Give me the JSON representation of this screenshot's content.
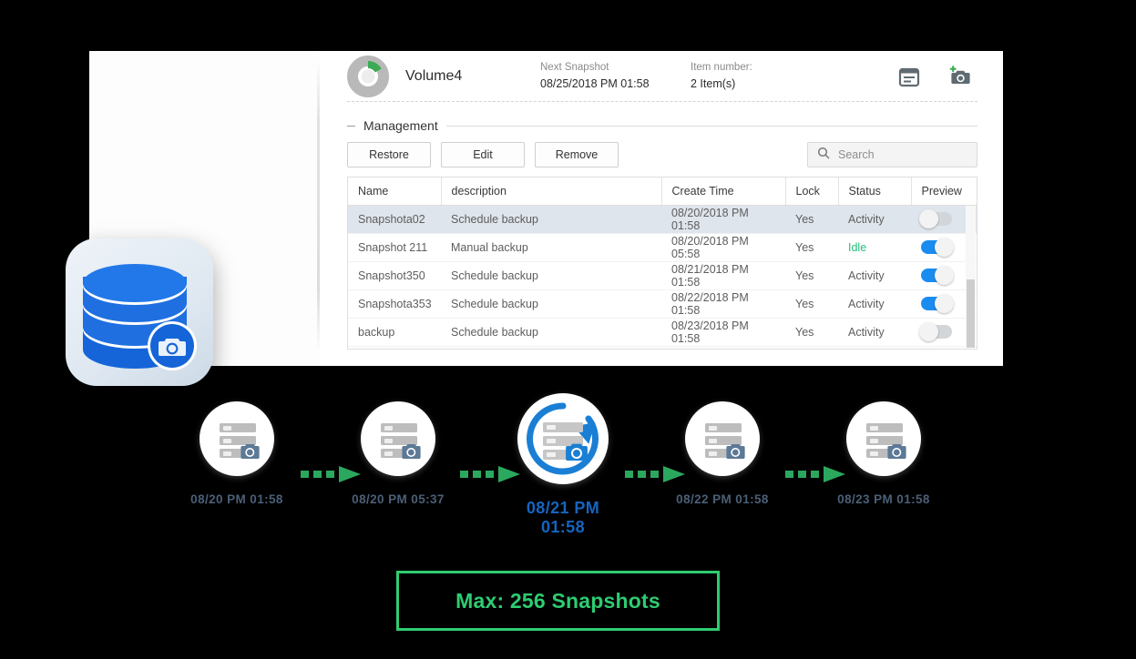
{
  "window": {
    "volume": {
      "donut_icon": "volume-usage-donut-icon",
      "name": "Volume4",
      "next_snapshot_label": "Next Snapshot",
      "next_snapshot_value": "08/25/2018 PM 01:58",
      "item_number_label": "Item number:",
      "item_number_value": "2 Item(s)",
      "icons": [
        {
          "name": "schedule-icon",
          "title": "Schedule"
        },
        {
          "name": "take-snapshot-icon",
          "title": "Take Snapshot"
        }
      ]
    },
    "management": {
      "legend": "Management",
      "buttons": [
        {
          "name": "restore-button",
          "label": "Restore"
        },
        {
          "name": "edit-button",
          "label": "Edit"
        },
        {
          "name": "remove-button",
          "label": "Remove"
        }
      ],
      "search": {
        "placeholder": "Search",
        "value": "Search",
        "icon": "search-icon"
      },
      "table": {
        "columns": [
          "Name",
          "description",
          "Create Time",
          "Lock",
          "Status",
          "Preview"
        ],
        "rows": [
          {
            "name": "Snapshota02",
            "description": "Schedule backup",
            "create_time": "08/20/2018 PM 01:58",
            "lock": "Yes",
            "status": "Activity",
            "preview": "off",
            "selected": true
          },
          {
            "name": "Snapshot 211",
            "description": "Manual backup",
            "create_time": "08/20/2018 PM 05:58",
            "lock": "Yes",
            "status": "Idle",
            "preview": "on",
            "selected": false
          },
          {
            "name": "Snapshot350",
            "description": "Schedule backup",
            "create_time": "08/21/2018 PM 01:58",
            "lock": "Yes",
            "status": "Activity",
            "preview": "on",
            "selected": false
          },
          {
            "name": "Snapshota353",
            "description": "Schedule backup",
            "create_time": "08/22/2018 PM 01:58",
            "lock": "Yes",
            "status": "Activity",
            "preview": "on",
            "selected": false
          },
          {
            "name": "backup",
            "description": "Schedule backup",
            "create_time": "08/23/2018 PM 01:58",
            "lock": "Yes",
            "status": "Activity",
            "preview": "off",
            "selected": false
          }
        ]
      }
    }
  },
  "app_icon": {
    "name": "database-snapshot-icon"
  },
  "timeline": {
    "nodes": [
      {
        "label": "08/20 PM 01:58",
        "active": false,
        "icon": "server-snapshot-icon"
      },
      {
        "label": "08/20 PM 05:37",
        "active": false,
        "icon": "server-snapshot-icon"
      },
      {
        "label": "08/21 PM 01:58",
        "active": true,
        "icon": "server-snapshot-restore-icon"
      },
      {
        "label": "08/22 PM 01:58",
        "active": false,
        "icon": "server-snapshot-icon"
      },
      {
        "label": "08/23 PM 01:58",
        "active": false,
        "icon": "server-snapshot-icon"
      }
    ],
    "arrow_icon": "dotted-arrow-right-icon"
  },
  "footer_badge": {
    "text": "Max: 256 Snapshots"
  },
  "colors": {
    "accent_blue": "#1565c0",
    "toggle_on": "#1a8cf0",
    "status_idle": "#24c07a",
    "arrow_green": "#2ba85e",
    "badge_green": "#2ecc71",
    "label_slate": "#4b5f77"
  }
}
